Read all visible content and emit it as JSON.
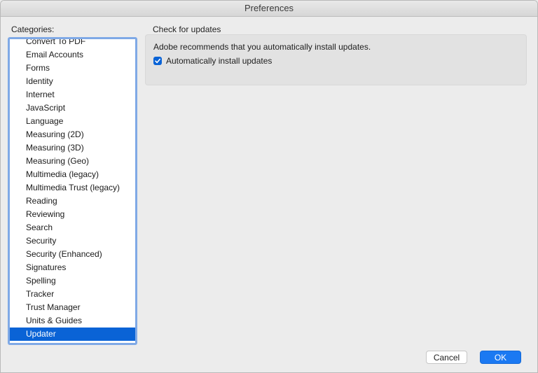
{
  "window": {
    "title": "Preferences"
  },
  "categories": {
    "label": "Categories:",
    "items": [
      "Convert To PDF",
      "Email Accounts",
      "Forms",
      "Identity",
      "Internet",
      "JavaScript",
      "Language",
      "Measuring (2D)",
      "Measuring (3D)",
      "Measuring (Geo)",
      "Multimedia (legacy)",
      "Multimedia Trust (legacy)",
      "Reading",
      "Reviewing",
      "Search",
      "Security",
      "Security (Enhanced)",
      "Signatures",
      "Spelling",
      "Tracker",
      "Trust Manager",
      "Units & Guides",
      "Updater"
    ],
    "selected": "Updater"
  },
  "updates": {
    "section_title": "Check for updates",
    "recommendation": "Adobe recommends that you automatically install updates.",
    "auto_install_label": "Automatically install updates",
    "auto_install_checked": true
  },
  "buttons": {
    "cancel": "Cancel",
    "ok": "OK"
  },
  "colors": {
    "accent": "#0a63d6",
    "focus_ring": "#7fa9e6"
  }
}
